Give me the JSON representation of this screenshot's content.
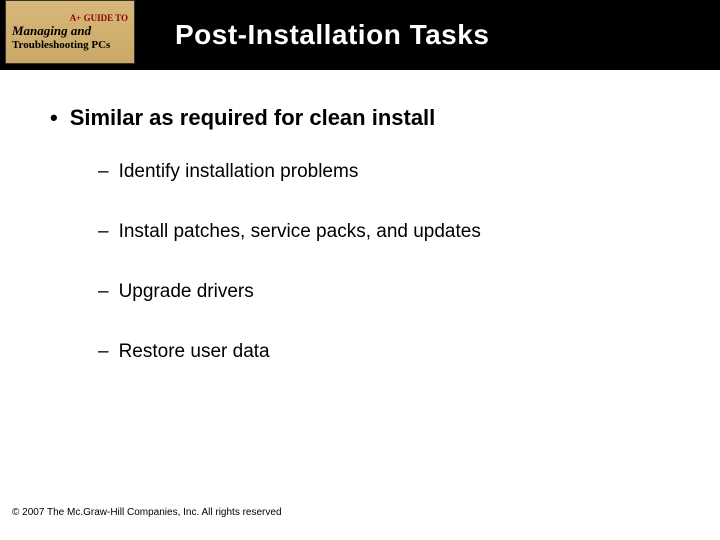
{
  "badge": {
    "top": "A+ GUIDE TO",
    "line1": "Managing and",
    "line2": "Troubleshooting PCs"
  },
  "title": "Post-Installation Tasks",
  "main_bullet": "Similar as required for clean install",
  "sub_items": [
    "Identify installation problems",
    "Install patches, service packs, and updates",
    "Upgrade drivers",
    "Restore user data"
  ],
  "footer": "© 2007 The Mc.Graw-Hill Companies, Inc. All rights reserved"
}
